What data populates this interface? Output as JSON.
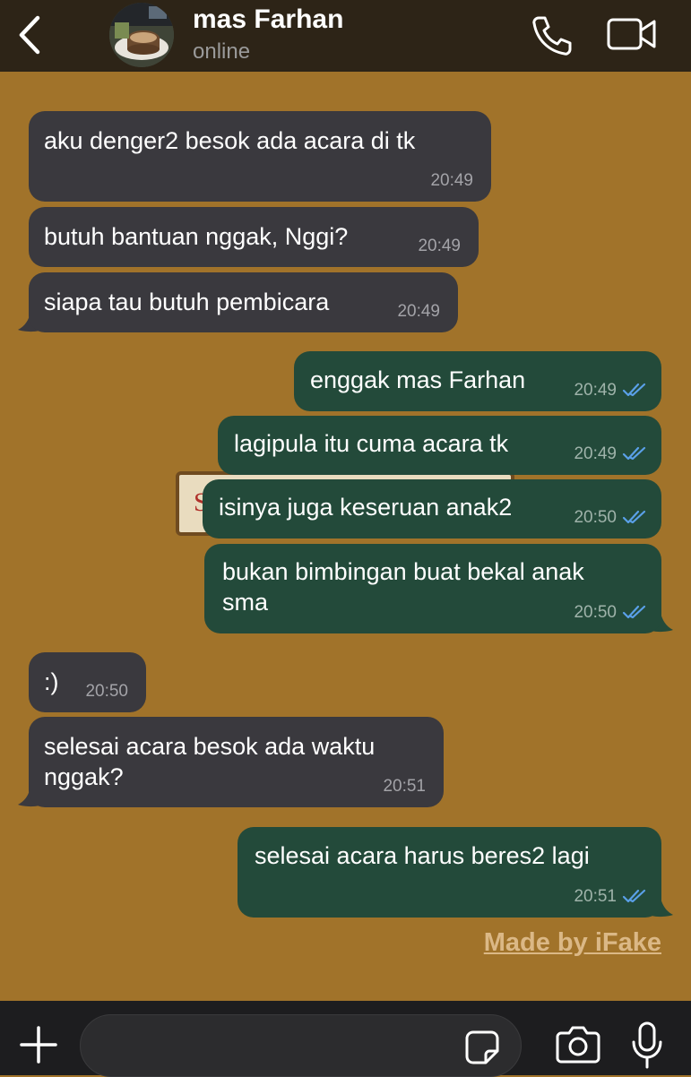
{
  "header": {
    "contact_name": "mas Farhan",
    "status": "online"
  },
  "messages": [
    {
      "direction": "incoming",
      "text": "aku denger2 besok ada acara di tk",
      "time": "20:49"
    },
    {
      "direction": "incoming",
      "text": "butuh bantuan nggak, Nggi?",
      "time": "20:49"
    },
    {
      "direction": "incoming",
      "text": "siapa tau butuh pembicara",
      "time": "20:49"
    },
    {
      "direction": "outgoing",
      "text": "enggak mas Farhan",
      "time": "20:49",
      "status": "read"
    },
    {
      "direction": "outgoing",
      "text": "lagipula itu cuma acara tk",
      "time": "20:49",
      "status": "read"
    },
    {
      "direction": "outgoing",
      "text": "isinya juga keseruan anak2",
      "time": "20:50",
      "status": "read"
    },
    {
      "direction": "outgoing",
      "text_line1": "bukan bimbingan buat bekal anak",
      "text_line2": "sma",
      "time": "20:50",
      "status": "read"
    },
    {
      "direction": "incoming",
      "text": ":)",
      "time": "20:50"
    },
    {
      "direction": "incoming",
      "text_line1": "selesai acara besok ada waktu",
      "text_line2": "nggak?",
      "time": "20:51"
    },
    {
      "direction": "outgoing",
      "text": "selesai acara harus beres2 lagi",
      "time": "20:51",
      "status": "read"
    }
  ],
  "watermark": "Made by iFake",
  "composer": {
    "value": "",
    "placeholder": ""
  },
  "icons": {
    "back": "chevron-left-icon",
    "call": "phone-icon",
    "video": "video-camera-icon",
    "plus": "plus-icon",
    "sticker": "sticker-icon",
    "camera": "camera-icon",
    "mic": "microphone-icon",
    "read_receipt": "double-check-icon"
  },
  "colors": {
    "header_bg": "#2d2417",
    "chat_bg": "#a1732a",
    "incoming_bubble": "#3a393e",
    "outgoing_bubble": "#234a3a",
    "read_check": "#5aa0e8",
    "bottom_bar": "#1d1d1f"
  }
}
